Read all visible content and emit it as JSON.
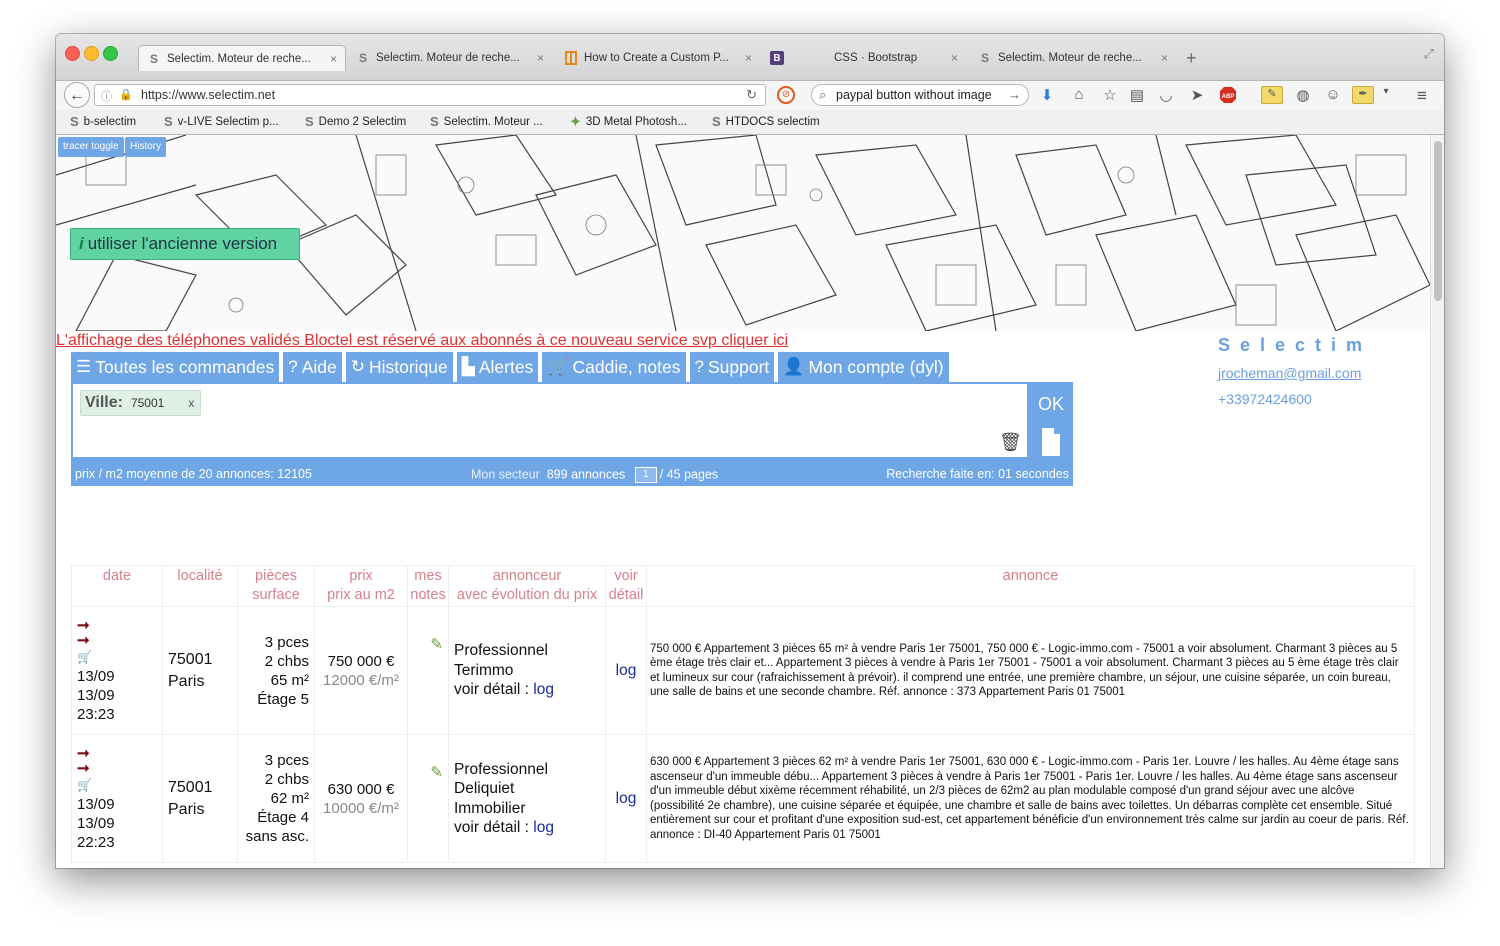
{
  "browser": {
    "tabs": [
      {
        "icon": "S",
        "label": "Selectim. Moteur de reche...",
        "close": "×",
        "active": true
      },
      {
        "icon": "S",
        "label": "Selectim. Moteur de reche...",
        "close": "×",
        "active": false
      },
      {
        "icon": "orange-book-icon",
        "label": "How to Create a Custom P...",
        "close": "×",
        "active": false
      },
      {
        "icon": "B",
        "label": "CSS · Bootstrap",
        "close": "×",
        "active": false
      },
      {
        "icon": "S",
        "label": "Selectim. Moteur de reche...",
        "close": "×",
        "active": false
      }
    ],
    "new_tab": "+",
    "url": "https://www.selectim.net",
    "search_value": "paypal button without image"
  },
  "bookmarks": [
    {
      "icon": "S",
      "label": "b-selectim"
    },
    {
      "icon": "S",
      "label": "v-LIVE Selectim p..."
    },
    {
      "icon": "S",
      "label": "Demo 2 Selectim"
    },
    {
      "icon": "S",
      "label": "Selectim. Moteur ..."
    },
    {
      "icon": "puzzle-icon",
      "label": "3D Metal Photosh..."
    },
    {
      "icon": "S",
      "label": "HTDOCS selectim"
    }
  ],
  "page": {
    "tracer_toggle": "tracer toggle",
    "history_btn": "History",
    "old_version": "utiliser l'ancienne version",
    "old_version_icon": "i",
    "notice": "L'affichage des téléphones validés Bloctel est réservé aux abonnés à ce nouveau service svp cliquer ici",
    "brand": "Selectim",
    "email": "jrocheman@gmail.com",
    "phone": "+33972424600",
    "menu": [
      {
        "icon": "☰",
        "label": "Toutes les commandes"
      },
      {
        "icon": "?",
        "label": "Aide"
      },
      {
        "icon": "↻",
        "label": "Historique"
      },
      {
        "icon": "▙",
        "label": "Alertes"
      },
      {
        "icon": "🛒",
        "label": "Caddie, notes"
      },
      {
        "icon": "?",
        "label": "Support"
      },
      {
        "icon": "👤",
        "label": "Mon compte (dyl)"
      }
    ],
    "search": {
      "chip_label": "Ville:",
      "chip_value": "75001",
      "chip_remove": "x",
      "ok": "OK"
    },
    "status": {
      "avg_price": "prix / m2 moyenne de 20 annonces: 12105",
      "sector_label": "Mon secteur",
      "sector_count": "899 annonces",
      "page": "1",
      "pages": "/ 45 pages",
      "time": "Recherche faite en: 01 secondes"
    },
    "table": {
      "headers": {
        "date": "date",
        "loc": "localité",
        "pieces": "pièces",
        "surface": "surface",
        "prix": "prix",
        "prix_m2": "prix au m2",
        "mes": "mes",
        "notes": "notes",
        "annonceur": "annonceur",
        "evolution": "avec évolution du prix",
        "voir": "voir",
        "detail": "détail",
        "annonce": "annonce"
      },
      "rows": [
        {
          "date1": "13/09",
          "date2": "13/09",
          "time": "23:23",
          "cp": "75001",
          "city": "Paris",
          "pcs": "3 pces",
          "chbs": "2 chbs",
          "surface": "65 m²",
          "etage": "Étage 5",
          "extra": "",
          "price": "750 000 €",
          "ppm": "12000 €/m²",
          "advertiser1": "Professionnel",
          "advertiser2": "Terimmo",
          "advertiser3": "",
          "voir_detail": "voir détail :",
          "log": "log",
          "voir_log": "log",
          "text": "750 000 € Appartement 3 pièces 65 m² à vendre Paris 1er 75001, 750 000 € - Logic-immo.com - 75001 a voir absolument. Charmant 3 pièces au 5 ème étage très clair et... Appartement 3 pièces à vendre à Paris 1er 75001 - 75001 a voir absolument. Charmant 3 pièces au 5 ème étage très clair et lumineux sur cour (rafraichissement à prévoir). il comprend une entrée, une première chambre, un séjour, une cuisine séparée, un coin bureau, une salle de bains et une seconde chambre. Réf. annonce : 373 Appartement Paris 01 75001"
        },
        {
          "date1": "13/09",
          "date2": "13/09",
          "time": "22:23",
          "cp": "75001",
          "city": "Paris",
          "pcs": "3 pces",
          "chbs": "2 chbs",
          "surface": "62 m²",
          "etage": "Étage 4",
          "extra": "sans asc.",
          "price": "630 000 €",
          "ppm": "10000 €/m²",
          "advertiser1": "Professionnel",
          "advertiser2": "Deliquiet",
          "advertiser3": "Immobilier",
          "voir_detail": "voir détail :",
          "log": "log",
          "voir_log": "log",
          "text": "630 000 € Appartement 3 pièces 62 m² à vendre Paris 1er 75001, 630 000 € - Logic-immo.com - Paris 1er. Louvre / les halles. Au 4ème étage sans ascenseur d'un immeuble débu... Appartement 3 pièces à vendre à Paris 1er 75001 - Paris 1er. Louvre / les halles. Au 4ème étage sans ascenseur d'un immeuble début xixème récemment réhabilité, un 2/3 pièces de 62m2 au plan modulable composé d'un grand séjour avec une alcôve (possibilité 2e chambre), une cuisine séparée et équipée, une chambre et salle de bains avec toilettes. Un débarras complète cet ensemble. Situé entièrement sur cour et profitant d'une exposition sud-est, cet appartement bénéficie d'un environnement très calme sur jardin au coeur de paris. Réf. annonce : DI-40 Appartement Paris 01 75001"
        }
      ]
    }
  },
  "colors": {
    "accent": "#6fa6e6",
    "notice": "#e03030",
    "header_text": "#d6818c",
    "link": "#1a2a9c",
    "old_version_bg": "#5fd3a1"
  }
}
